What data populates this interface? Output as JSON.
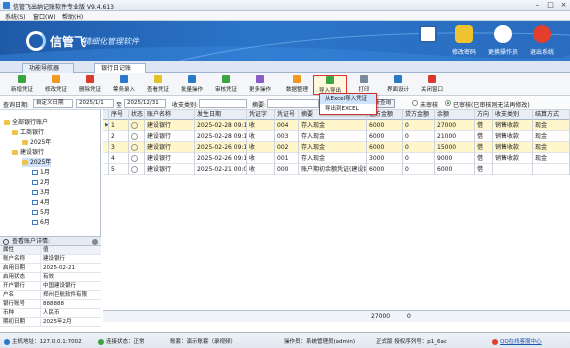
{
  "window": {
    "title": "信管飞出纳记账软件专业版 V9.4.613"
  },
  "menubar": {
    "items": [
      "系统(S)",
      "窗口(W)",
      "帮助(H)"
    ]
  },
  "banner": {
    "brand": "信管飞",
    "slogan": "精细化管理软件",
    "actions": [
      {
        "label": "",
        "icon": "list-icon"
      },
      {
        "label": "修改密码",
        "icon": "lock-icon"
      },
      {
        "label": "更换操作员",
        "icon": "user-icon"
      },
      {
        "label": "退出系统",
        "icon": "exit-icon"
      }
    ]
  },
  "tabs": [
    {
      "label": "功能导航器"
    },
    {
      "label": "银行日记账"
    }
  ],
  "toolbar": {
    "buttons": [
      {
        "label": "新增凭证",
        "color": "#3aa543"
      },
      {
        "label": "修改凭证",
        "color": "#f29a1f"
      },
      {
        "label": "删除凭证",
        "color": "#d83a2c"
      },
      {
        "label": "筹务录入",
        "color": "#2b78c8"
      },
      {
        "label": "查看凭证",
        "color": "#e2c227"
      },
      {
        "label": "批量操作",
        "color": "#2b78c8"
      },
      {
        "label": "审核凭证",
        "color": "#3aa543"
      },
      {
        "label": "更多操作",
        "color": "#8a5cc6"
      },
      {
        "label": "数据整理",
        "color": "#f29a1f"
      },
      {
        "label": "导入导出",
        "color": "#3aa543"
      },
      {
        "label": "打印",
        "color": "#7d8a99"
      },
      {
        "label": "界面设计",
        "color": "#2b78c8"
      },
      {
        "label": "关闭窗口",
        "color": "#d83a2c"
      }
    ],
    "dropdown": [
      "从Excel导入凭证",
      "导出到EXCEL"
    ]
  },
  "filter": {
    "date_label": "查询日期:",
    "date_mode": "自定义日期",
    "date_from": "2025/1/1",
    "to_label": "至",
    "date_to": "2025/12/31",
    "category_label": "收支类别:",
    "category_value": "",
    "summary_label": "摘要:",
    "summary_value": "",
    "query_button": "查询",
    "refresh_button": "刷新查询",
    "unaudited_label": "未审核",
    "audited_label": "已审核(已审核则无法再修改)"
  },
  "tree": {
    "items": [
      {
        "label": "全部银行账户"
      },
      {
        "label": "工商银行"
      },
      {
        "label": "2025年"
      },
      {
        "label": "建设银行"
      },
      {
        "label": "2025年"
      },
      {
        "label": "1月"
      },
      {
        "label": "2月"
      },
      {
        "label": "3月"
      },
      {
        "label": "4月"
      },
      {
        "label": "5月"
      },
      {
        "label": "6月"
      }
    ]
  },
  "detail": {
    "title": "查看账户详情:",
    "head": {
      "k": "属性",
      "v": "值"
    },
    "rows": [
      {
        "k": "账户名称",
        "v": "建设银行"
      },
      {
        "k": "启用日期",
        "v": "2025-02-21"
      },
      {
        "k": "启用状态",
        "v": "有效"
      },
      {
        "k": "开户银行",
        "v": "中国建设银行"
      },
      {
        "k": "户名",
        "v": "郑州巨航软件有限"
      },
      {
        "k": "银行账号",
        "v": "888888"
      },
      {
        "k": "币种",
        "v": "人民币"
      },
      {
        "k": "期初日期",
        "v": "2025年2月"
      }
    ]
  },
  "grid": {
    "columns": [
      "序号",
      "状态",
      "账户名称",
      "发生日期",
      "凭证字",
      "凭证号",
      "摘要",
      "借方金额",
      "贷方金额",
      "余额",
      "方向",
      "收支类别",
      "结算方式"
    ],
    "rows": [
      {
        "no": "1",
        "account": "建设银行",
        "date": "2025-02-28 09:13",
        "word": "收",
        "num": "004",
        "summary": "存入现金",
        "debit": "6000",
        "credit": "0",
        "balance": "27000",
        "dir": "借",
        "category": "销售收款",
        "settle": "现金"
      },
      {
        "no": "2",
        "account": "建设银行",
        "date": "2025-02-28 09:13",
        "word": "收",
        "num": "003",
        "summary": "存入现金",
        "debit": "6000",
        "credit": "0",
        "balance": "21000",
        "dir": "借",
        "category": "销售收款",
        "settle": "现金"
      },
      {
        "no": "3",
        "account": "建设银行",
        "date": "2025-02-26 09:12",
        "word": "收",
        "num": "002",
        "summary": "存入现金",
        "debit": "6000",
        "credit": "0",
        "balance": "15000",
        "dir": "借",
        "category": "销售收款",
        "settle": "现金"
      },
      {
        "no": "4",
        "account": "建设银行",
        "date": "2025-02-26 09:12",
        "word": "收",
        "num": "001",
        "summary": "存入现金",
        "debit": "3000",
        "credit": "0",
        "balance": "9000",
        "dir": "借",
        "category": "销售收款",
        "settle": "现金"
      },
      {
        "no": "5",
        "account": "建设银行",
        "date": "2025-02-21 00:00",
        "word": "收",
        "num": "000",
        "summary": "账户期初余额凭证(建设银",
        "debit": "6000",
        "credit": "0",
        "balance": "6000",
        "dir": "借",
        "category": "",
        "settle": ""
      }
    ],
    "totals": {
      "debit": "27000",
      "credit": "0"
    }
  },
  "statusbar": {
    "server": "主机地址：127.0.0.1:7002",
    "connection": "连接状态：正常",
    "company": "账套：演示账套（录视频）",
    "operator": "操作员：系统管理员(admin)",
    "edition": "正式版 授权序列号：p1_6ac",
    "support": "QQ在线客服中心"
  },
  "colors": {
    "banner": "#2b75c9",
    "selected_row": "#fff6cc",
    "highlight_border": "#dd3333"
  }
}
